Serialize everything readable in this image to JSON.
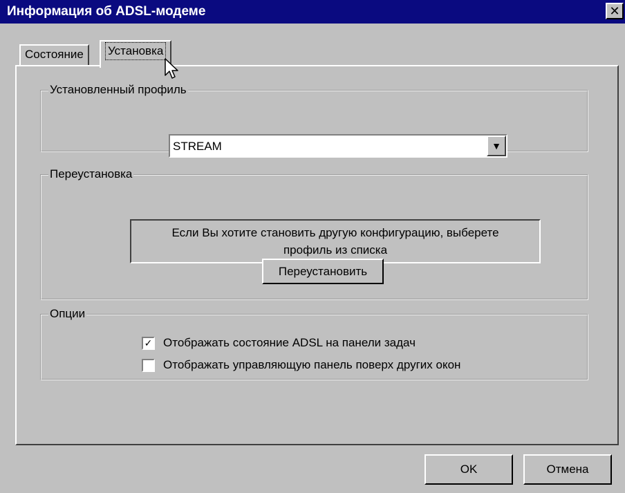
{
  "window": {
    "title": "Информация об ADSL-модеме",
    "close_glyph": "✕"
  },
  "tabs": [
    {
      "label": "Состояние",
      "active": false
    },
    {
      "label": "Установка",
      "active": true
    }
  ],
  "installed_profile": {
    "legend": "Установленный профиль",
    "selected": "STREAM",
    "dropdown_glyph": "▼"
  },
  "reinstall": {
    "legend": "Переустановка",
    "info_line1": "Если Вы хотите становить другую конфигурацию, выберете",
    "info_line2": "профиль из списка",
    "button_label": "Переустановить"
  },
  "options": {
    "legend": "Опции",
    "items": [
      {
        "label": "Отображать состояние ADSL на панели задач",
        "checked": true
      },
      {
        "label": "Отображать управляющую панель поверх других окон",
        "checked": false
      }
    ],
    "check_glyph": "✓"
  },
  "footer": {
    "ok_label": "OK",
    "cancel_label": "Отмена"
  },
  "colors": {
    "titlebar": "#0a0a80",
    "face": "#c0c0c0"
  },
  "icons": {
    "cursor": "arrow-cursor-icon"
  }
}
